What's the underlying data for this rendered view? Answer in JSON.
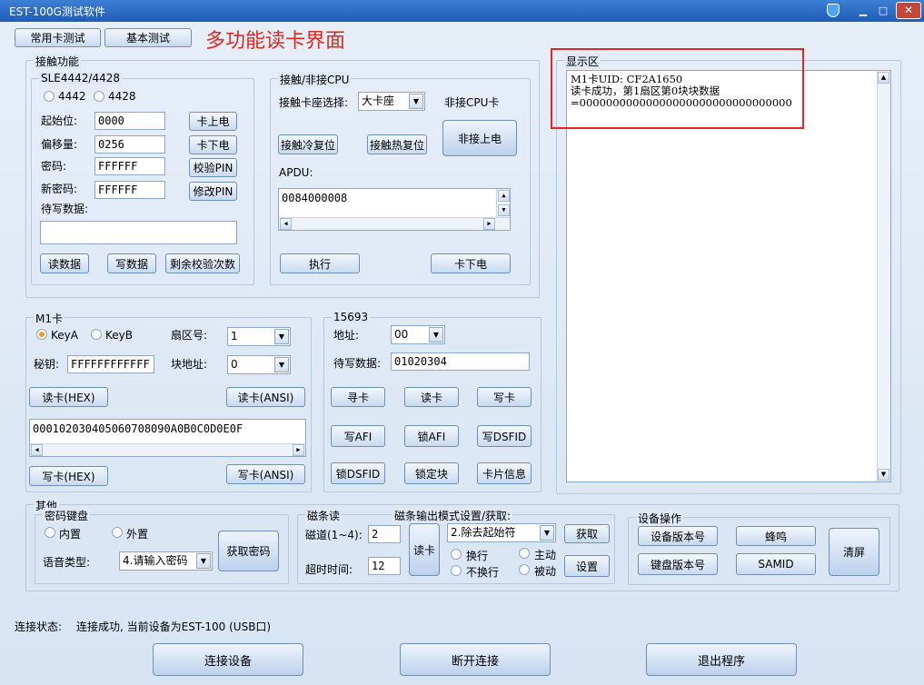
{
  "window": {
    "title": "EST-100G测试软件",
    "minimize": "▁",
    "restore": "□",
    "close": "✕"
  },
  "top_tabs": {
    "common": "常用卡测试",
    "basic": "基本测试"
  },
  "annotation": "多功能读卡界面",
  "contact": {
    "group_label": "接触功能",
    "sle": {
      "label": "SLE4442/4428",
      "radio1": "4442",
      "radio2": "4428",
      "start_label": "起始位:",
      "start_value": "0000",
      "offset_label": "偏移量:",
      "offset_value": "0256",
      "pwd_label": "密码:",
      "pwd_value": "FFFFFF",
      "newpwd_label": "新密码:",
      "newpwd_value": "FFFFFF",
      "write_label": "待写数据:",
      "write_value": "",
      "power_on": "卡上电",
      "power_off": "卡下电",
      "verify_pin": "校验PIN",
      "change_pin": "修改PIN",
      "read": "读数据",
      "write": "写数据",
      "remain": "剩余校验次数"
    },
    "cpu": {
      "label": "接触/非接CPU",
      "slot_label": "接触卡座选择:",
      "slot_value": "大卡座",
      "noncontact_label": "非接CPU卡",
      "cold_reset": "接触冷复位",
      "hot_reset": "接触热复位",
      "nc_power_on": "非接上电",
      "apdu_label": "APDU:",
      "apdu_value": "0084000008",
      "execute": "执行",
      "power_off": "卡下电"
    }
  },
  "display": {
    "label": "显示区",
    "lines": [
      "M1卡UID: CF2A1650",
      "读卡成功，第1扇区第0块块数据",
      "=00000000000000000000000000000000"
    ]
  },
  "m1": {
    "label": "M1卡",
    "keyA": "KeyA",
    "keyB": "KeyB",
    "sector_label": "扇区号:",
    "sector_value": "1",
    "key_label": "秘钥:",
    "key_value": "FFFFFFFFFFFF",
    "block_label": "块地址:",
    "block_value": "0",
    "read_hex": "读卡(HEX)",
    "read_ansi": "读卡(ANSI)",
    "data_value": "000102030405060708090A0B0C0D0E0F",
    "write_hex": "写卡(HEX)",
    "write_ansi": "写卡(ANSI)"
  },
  "iso15693": {
    "label": "15693",
    "addr_label": "地址:",
    "addr_value": "00",
    "write_label": "待写数据:",
    "write_value": "01020304",
    "find": "寻卡",
    "read": "读卡",
    "write": "写卡",
    "write_afi": "写AFI",
    "lock_afi": "锁AFI",
    "write_dsfid": "写DSFID",
    "lock_dsfid": "锁DSFID",
    "lock_block": "锁定块",
    "card_info": "卡片信息"
  },
  "other": {
    "label": "其他",
    "keypad": {
      "label": "密码键盘",
      "internal": "内置",
      "external": "外置",
      "voice_label": "语音类型:",
      "voice_value": "4.请输入密码",
      "get_pwd": "获取密码"
    },
    "magnetic": {
      "label": "磁条读",
      "track_label": "磁道(1~4):",
      "track_value": "2",
      "timeout_label": "超时时间:",
      "timeout_value": "12",
      "read": "读卡"
    },
    "mag_out": {
      "label": "磁条输出模式设置/获取:",
      "mode_value": "2.除去起始符",
      "get": "获取",
      "set": "设置",
      "wrap": "换行",
      "nowrap": "不换行",
      "active": "主动",
      "passive": "被动"
    },
    "device": {
      "label": "设备操作",
      "dev_version": "设备版本号",
      "beep": "蜂鸣",
      "kb_version": "键盘版本号",
      "samid": "SAMID",
      "clear": "清屏"
    }
  },
  "status": {
    "label": "连接状态:",
    "value": "连接成功, 当前设备为EST-100 (USB口)"
  },
  "bottom": {
    "connect": "连接设备",
    "disconnect": "断开连接",
    "exit": "退出程序"
  },
  "colors": {
    "annotation": "#e8261c",
    "titlebar": "#2a6cc6",
    "radio_on": "#f39c1c"
  }
}
